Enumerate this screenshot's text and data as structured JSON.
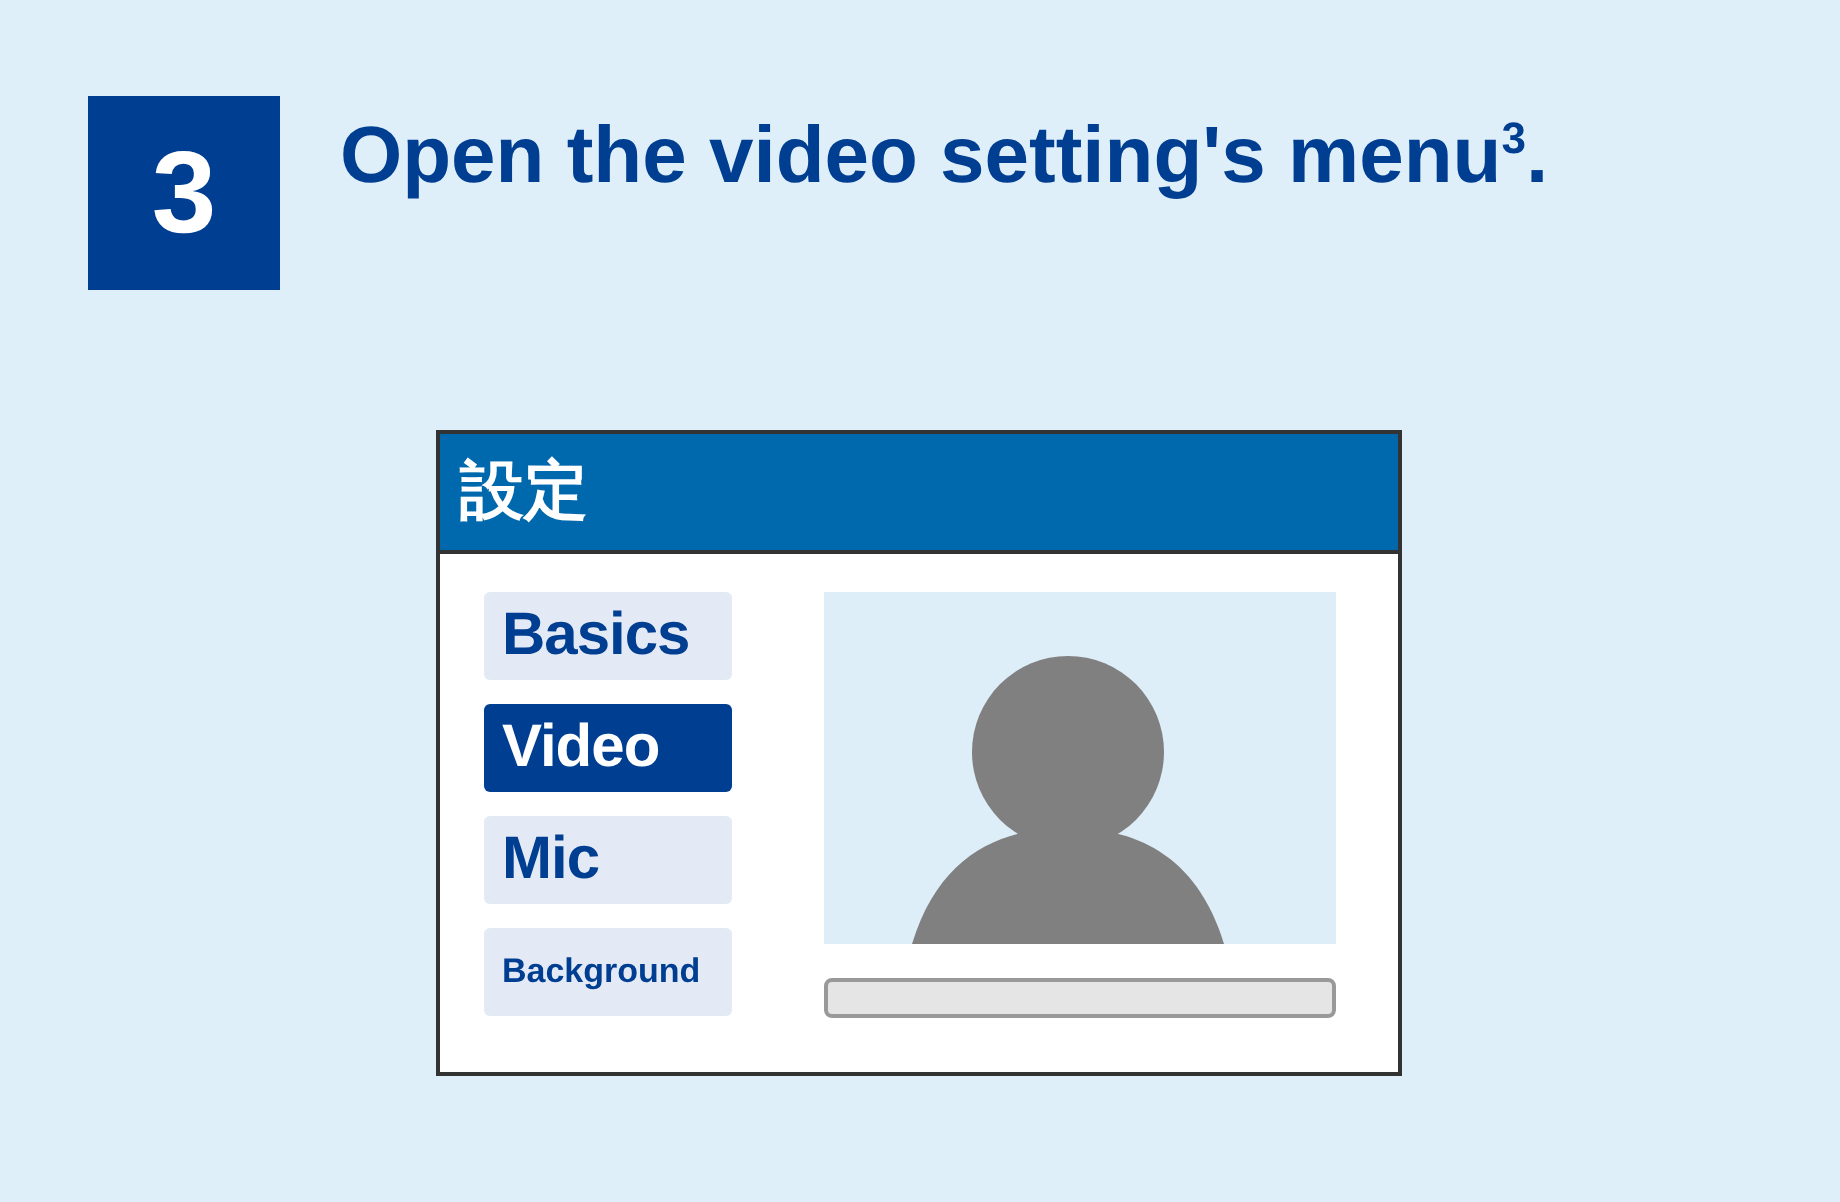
{
  "step": {
    "number": "3",
    "title": "Open the video setting's menu$^{3}$."
  },
  "window": {
    "title": "設定",
    "menu": [
      {
        "label": "Basics",
        "selected": false
      },
      {
        "label": "Video",
        "selected": true
      },
      {
        "label": "Mic",
        "selected": false
      },
      {
        "label": "Background",
        "selected": false
      }
    ]
  }
}
